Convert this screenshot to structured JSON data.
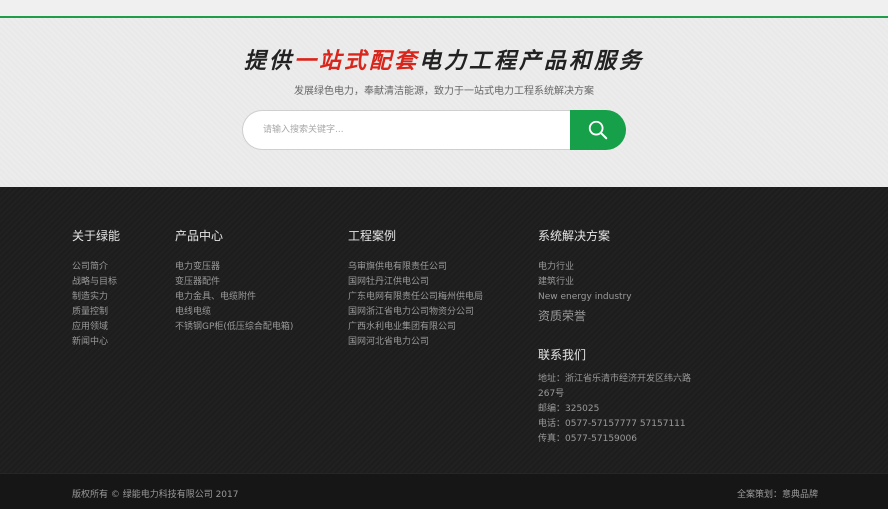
{
  "hero": {
    "slogan_prefix": "提供",
    "slogan_highlight": "一站式配套",
    "slogan_suffix": "电力工程产品和服务",
    "subtitle": "发展绿色电力，奉献清洁能源，致力于一站式电力工程系统解决方案",
    "search_placeholder": "请输入搜索关键字...",
    "accent_color": "#1f9d4a",
    "highlight_color": "#d9261c"
  },
  "footer": {
    "about": {
      "title": "关于绿能",
      "items": [
        "公司简介",
        "战略与目标",
        "制造实力",
        "质量控制",
        "应用领域",
        "新闻中心"
      ]
    },
    "products": {
      "title": "产品中心",
      "items": [
        "电力变压器",
        "变压器配件",
        "电力金具、电缆附件",
        "电线电缆",
        "不锈钢GP柜(低压综合配电箱)"
      ]
    },
    "cases": {
      "title": "工程案例",
      "items": [
        "乌审旗供电有限责任公司",
        "国网牡丹江供电公司",
        "广东电网有限责任公司梅州供电局",
        "国网浙江省电力公司物资分公司",
        "广西水利电业集团有限公司",
        "国网河北省电力公司"
      ]
    },
    "solutions": {
      "title": "系统解决方案",
      "items": [
        "电力行业",
        "建筑行业",
        "New energy industry"
      ]
    },
    "honors": {
      "title": "资质荣誉"
    },
    "contact": {
      "title": "联系我们",
      "address": "地址：浙江省乐清市经济开发区纬六路267号",
      "postcode": "邮编：325025",
      "phone": "电话：0577-57157777 57157111",
      "fax": "传真：0577-57159006"
    }
  },
  "bottom": {
    "copyright": "版权所有 © 绿能电力科技有限公司 2017",
    "credit": "全案策划：意典品牌"
  }
}
